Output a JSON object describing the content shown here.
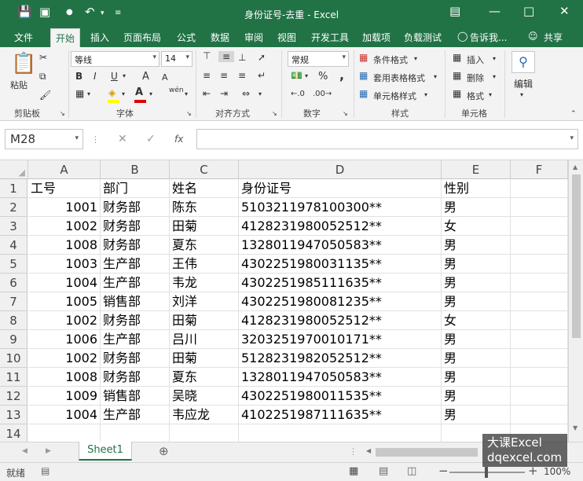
{
  "window": {
    "title": "身份证号-去重 - Excel"
  },
  "tabs": [
    "文件",
    "开始",
    "插入",
    "页面布局",
    "公式",
    "数据",
    "审阅",
    "视图",
    "开发工具",
    "加载项",
    "负载测试"
  ],
  "tell_me": "告诉我...",
  "share": "共享",
  "ribbon": {
    "paste": "粘贴",
    "font_name": "等线",
    "font_size": "14",
    "bold": "B",
    "italic": "I",
    "underline": "U",
    "grow_font": "A",
    "shrink_font": "A",
    "wen": "wén",
    "number_format": "常规",
    "percent": "%",
    "comma": ",",
    "cond_format": "条件格式",
    "table_format": "套用表格格式",
    "cell_style": "单元格样式",
    "insert": "插入",
    "delete": "删除",
    "format": "格式",
    "edit": "编辑",
    "groups": [
      "剪贴板",
      "字体",
      "对齐方式",
      "数字",
      "样式",
      "单元格"
    ]
  },
  "formula_bar": {
    "name_box": "M28",
    "fx": "fx",
    "value": ""
  },
  "columns": [
    "A",
    "B",
    "C",
    "D",
    "E",
    "F"
  ],
  "rows": [
    {
      "n": "1",
      "a": "工号",
      "b": "部门",
      "c": "姓名",
      "d": "身份证号",
      "e": "性别"
    },
    {
      "n": "2",
      "a": "1001",
      "b": "财务部",
      "c": "陈东",
      "d": "5103211978100300**",
      "e": "男"
    },
    {
      "n": "3",
      "a": "1002",
      "b": "财务部",
      "c": "田菊",
      "d": "4128231980052512**",
      "e": "女"
    },
    {
      "n": "4",
      "a": "1008",
      "b": "财务部",
      "c": "夏东",
      "d": "1328011947050583**",
      "e": "男"
    },
    {
      "n": "5",
      "a": "1003",
      "b": "生产部",
      "c": "王伟",
      "d": "4302251980031135**",
      "e": "男"
    },
    {
      "n": "6",
      "a": "1004",
      "b": "生产部",
      "c": "韦龙",
      "d": "4302251985111635**",
      "e": "男"
    },
    {
      "n": "7",
      "a": "1005",
      "b": "销售部",
      "c": "刘洋",
      "d": "4302251980081235**",
      "e": "男"
    },
    {
      "n": "8",
      "a": "1002",
      "b": "财务部",
      "c": "田菊",
      "d": "4128231980052512**",
      "e": "女"
    },
    {
      "n": "9",
      "a": "1006",
      "b": "生产部",
      "c": "吕川",
      "d": "3203251970010171**",
      "e": "男"
    },
    {
      "n": "10",
      "a": "1002",
      "b": "财务部",
      "c": "田菊",
      "d": "5128231982052512**",
      "e": "男"
    },
    {
      "n": "11",
      "a": "1008",
      "b": "财务部",
      "c": "夏东",
      "d": "1328011947050583**",
      "e": "男"
    },
    {
      "n": "12",
      "a": "1009",
      "b": "销售部",
      "c": "吴晓",
      "d": "4302251980011535**",
      "e": "男"
    },
    {
      "n": "13",
      "a": "1004",
      "b": "生产部",
      "c": "韦应龙",
      "d": "4102251987111635**",
      "e": "男"
    },
    {
      "n": "14",
      "a": "",
      "b": "",
      "c": "",
      "d": "",
      "e": ""
    }
  ],
  "sheet_tab": "Sheet1",
  "status": {
    "ready": "就绪",
    "zoom": "100%"
  },
  "watermark": {
    "line1": "大课Excel",
    "line2": "dqexcel.com"
  }
}
